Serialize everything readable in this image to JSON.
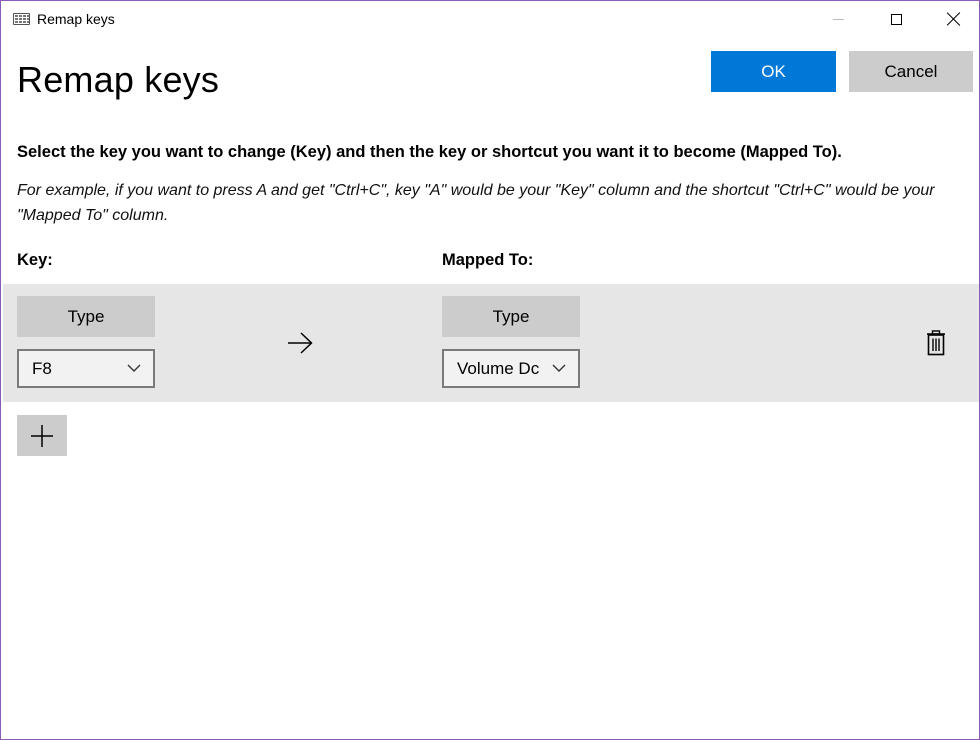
{
  "window": {
    "title": "Remap keys",
    "app_icon": "keyboard-icon",
    "controls": [
      "minimize-icon",
      "maximize-icon",
      "close-icon"
    ]
  },
  "header": {
    "title": "Remap keys",
    "ok_label": "OK",
    "cancel_label": "Cancel"
  },
  "instructions": {
    "main": "Select the key you want to change (Key) and then the key or shortcut you want it to become (Mapped To).",
    "example": "For example, if you want to press A and get \"Ctrl+C\", key \"A\" would be your \"Key\" column and the shortcut \"Ctrl+C\" would be your \"Mapped To\" column."
  },
  "columns": {
    "key_label": "Key:",
    "mapped_label": "Mapped To:"
  },
  "mappings": [
    {
      "key_type_label": "Type",
      "key_value": "F8",
      "mapped_type_label": "Type",
      "mapped_value": "Volume Dc",
      "arrow_icon": "arrow-right-icon",
      "delete_icon": "trash-icon"
    }
  ],
  "add_button_icon": "plus-icon",
  "colors": {
    "accent": "#0078d7",
    "button_gray": "#cccccc",
    "row_background": "#e6e6e6",
    "window_border": "#8a5bb8"
  }
}
